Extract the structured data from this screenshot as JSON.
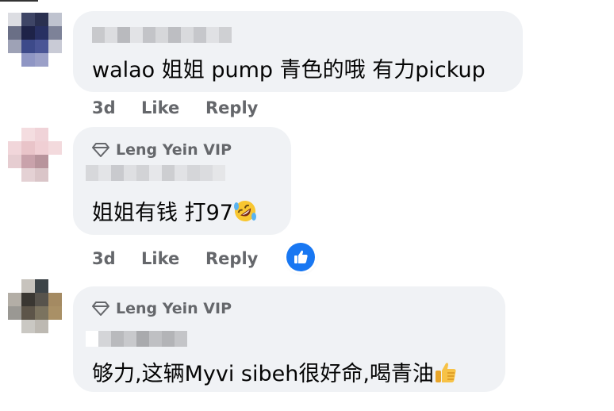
{
  "comments": [
    {
      "text": "walao 姐姐 pump 青色的哦 有力pickup",
      "time": "3d",
      "like_label": "Like",
      "reply_label": "Reply"
    },
    {
      "badge": "Leng Yein VIP",
      "text": "姐姐有钱 打97",
      "emoji": "rolling-on-floor-laughing",
      "time": "3d",
      "like_label": "Like",
      "reply_label": "Reply",
      "reaction": "like-reaction-icon"
    },
    {
      "badge": "Leng Yein VIP",
      "text": "够力,这辆Myvi sibeh很好命,喝青油",
      "emoji": "thumbs-up"
    }
  ],
  "colors": {
    "bubble": "#f0f2f5",
    "text": "#050505",
    "meta": "#65676b",
    "like_blue": "#1877f2"
  }
}
